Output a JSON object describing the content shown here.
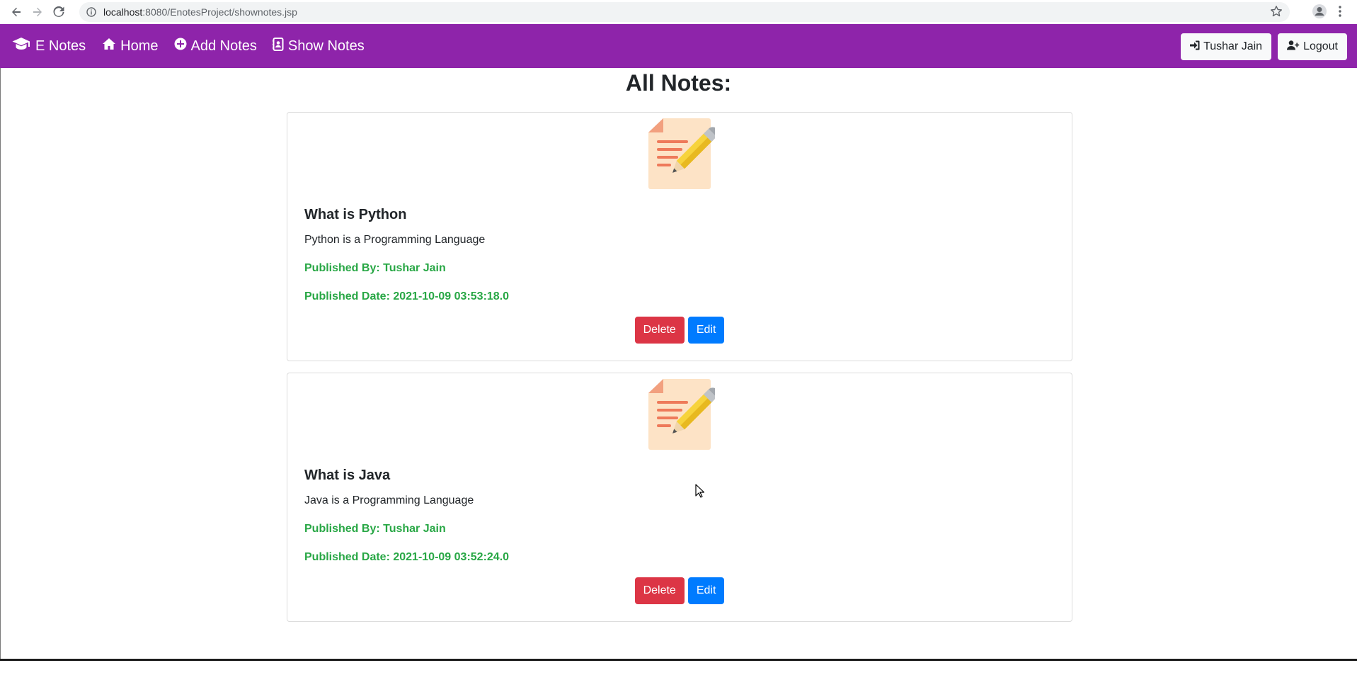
{
  "browser": {
    "url_host": "localhost",
    "url_path": ":8080/EnotesProject/shownotes.jsp"
  },
  "navbar": {
    "brand": "E Notes",
    "links": [
      {
        "label": "Home",
        "icon": "home-icon"
      },
      {
        "label": "Add Notes",
        "icon": "plus-circle-icon"
      },
      {
        "label": "Show Notes",
        "icon": "address-book-icon"
      }
    ],
    "user_button": "Tushar Jain",
    "logout_button": "Logout"
  },
  "main": {
    "title": "All Notes:",
    "notes": [
      {
        "title": "What is Python",
        "content": "Python is a Programming Language",
        "published_by": "Published By: Tushar Jain",
        "published_date": "Published Date: 2021-10-09 03:53:18.0",
        "delete_label": "Delete",
        "edit_label": "Edit"
      },
      {
        "title": "What is Java",
        "content": "Java is a Programming Language",
        "published_by": "Published By: Tushar Jain",
        "published_date": "Published Date: 2021-10-09 03:52:24.0",
        "delete_label": "Delete",
        "edit_label": "Edit"
      }
    ]
  },
  "colors": {
    "navbar": "#8e24aa",
    "published_text": "#28a745",
    "delete_button": "#dc3545",
    "edit_button": "#007bff"
  }
}
